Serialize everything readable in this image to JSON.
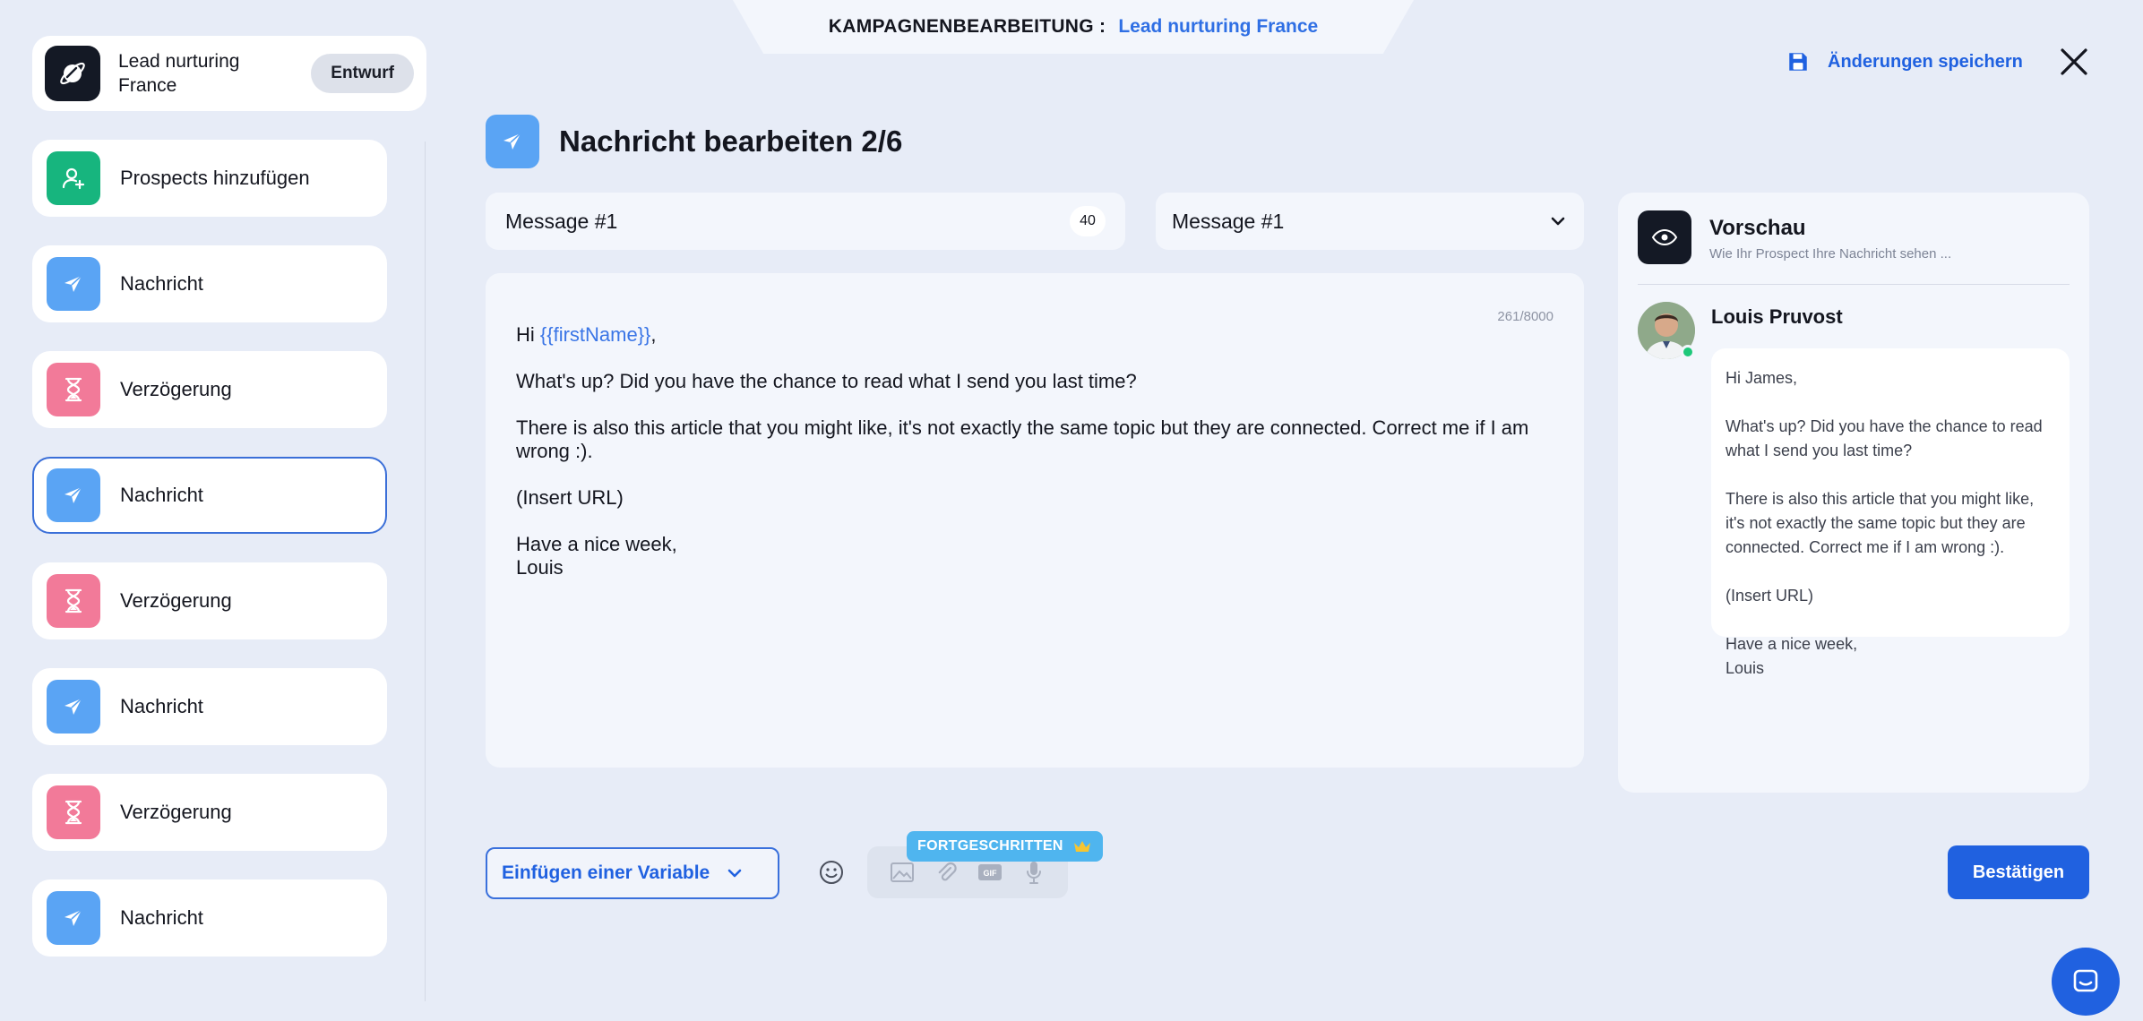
{
  "header": {
    "kicker": "KAMPAGNENBEARBEITUNG :",
    "campaign_name": "Lead nurturing France",
    "save_label": "Änderungen speichern"
  },
  "sidebar": {
    "campaign": {
      "name": "Lead nurturing France",
      "status": "Entwurf"
    },
    "steps": [
      {
        "label": "Prospects hinzufügen",
        "icon": "add-user-icon",
        "color": "#17b57e"
      },
      {
        "label": "Nachricht",
        "icon": "paper-plane-icon",
        "color": "#5aa4f4"
      },
      {
        "label": "Verzögerung",
        "icon": "hourglass-icon",
        "color": "#f27a99"
      },
      {
        "label": "Nachricht",
        "icon": "paper-plane-icon",
        "color": "#5aa4f4",
        "active": true
      },
      {
        "label": "Verzögerung",
        "icon": "hourglass-icon",
        "color": "#f27a99"
      },
      {
        "label": "Nachricht",
        "icon": "paper-plane-icon",
        "color": "#5aa4f4"
      },
      {
        "label": "Verzögerung",
        "icon": "hourglass-icon",
        "color": "#f27a99"
      },
      {
        "label": "Nachricht",
        "icon": "paper-plane-icon",
        "color": "#5aa4f4"
      }
    ]
  },
  "editor": {
    "title": "Nachricht bearbeiten 2/6",
    "name_value": "Message #1",
    "name_count": "40",
    "select_value": "Message #1",
    "char_counter": "261/8000",
    "body": {
      "greeting_prefix": "Hi ",
      "greeting_variable": "{{firstName}}",
      "greeting_suffix": ",",
      "line1": "What's up? Did you have the chance to read what I send you last time?",
      "line2": "There is also this article that you might like, it's not exactly the same topic but they are connected. Correct me if I am wrong :).",
      "line3": "(Insert URL)",
      "closing1": "Have a nice week,",
      "closing2": "Louis"
    },
    "toolbar": {
      "insert_variable_label": "Einfügen einer Variable",
      "advanced_badge": "FORTGESCHRITTEN",
      "confirm_label": "Bestätigen"
    }
  },
  "preview": {
    "title": "Vorschau",
    "subtitle": "Wie Ihr Prospect Ihre Nachricht sehen ...",
    "sender": "Louis Pruvost",
    "greeting": "Hi James,",
    "line1": "What's up? Did you have the chance to read what I send you last time?",
    "line2": "There is also this article that you might like, it's not exactly the same topic but they are connected. Correct me if I am wrong :).",
    "line3": "(Insert URL)",
    "closing1": "Have a nice week,",
    "closing2": "Louis"
  },
  "colors": {
    "accent": "#2061e0",
    "background": "#e7ecf7",
    "card": "#f3f6fc",
    "green": "#17b57e",
    "blue": "#5aa4f4",
    "pink": "#f27a99",
    "dark": "#141925"
  }
}
